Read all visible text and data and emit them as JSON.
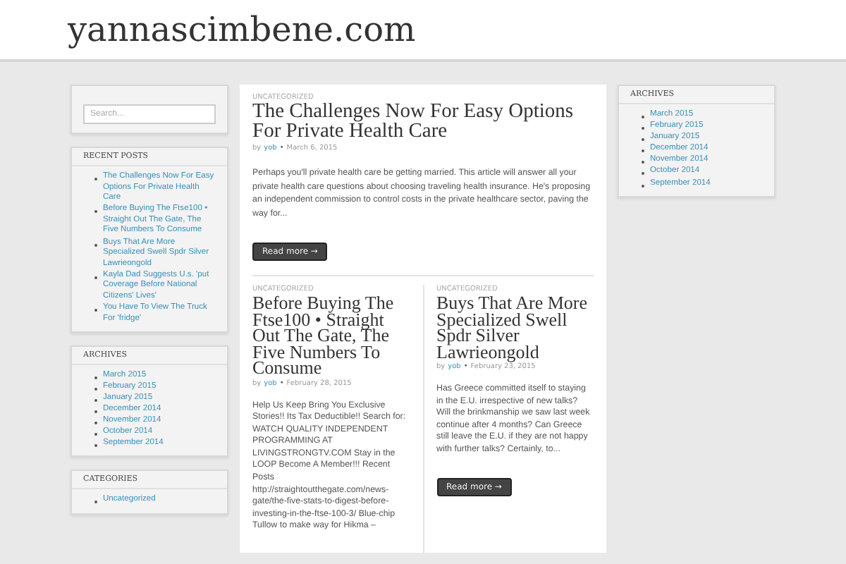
{
  "site_title": "yannascimbene.com",
  "left_sidebar": {
    "search": {
      "placeholder": "Search..."
    },
    "widgets": [
      {
        "title": "RECENT POSTS",
        "items": [
          "The Challenges Now For Easy Options For Private Health Care",
          "Before Buying The Ftse100 • Straight Out The Gate, The Five Numbers To Consume",
          "Buys That Are More Specialized Swell Spdr Silver Lawrieongold",
          "Kayla Dad Suggests U.s. 'put Coverage Before National Citizens' Lives'",
          "You Have To View The Truck For 'fridge'"
        ]
      },
      {
        "title": "ARCHIVES",
        "items": [
          "March 2015",
          "February 2015",
          "January 2015",
          "December 2014",
          "November 2014",
          "October 2014",
          "September 2014"
        ]
      },
      {
        "title": "CATEGORIES",
        "items": [
          "Uncategorized"
        ]
      }
    ]
  },
  "featured_post": {
    "category": "UNCATEGORIZED",
    "title": "The Challenges Now For Easy Options For Private Health Care",
    "by": "by",
    "author": "yob",
    "separator": "•",
    "date": "March 6, 2015",
    "excerpt": "Perhaps you'll private health care be getting married. This article will answer all your private health care questions about choosing traveling health insurance. He's proposing an independent commission to control costs in the private healthcare sector, paving the way for...",
    "button": "Read more →"
  },
  "posts": [
    {
      "category": "UNCATEGORIZED",
      "title": "Before Buying The Ftse100 • Straight Out The Gate, The Five Numbers To Consume",
      "by": "by",
      "author": "yob",
      "separator": "•",
      "date": "February 28, 2015",
      "excerpt": "Help Us Keep Bring You Exclusive Stories!! Its Tax Deductible!! Search for: WATCH QUALITY INDEPENDENT PROGRAMMING AT LIVINGSTRONGTV.COM Stay in the LOOP Become A Member!!! Recent Posts http://straightoutthegate.com/news-gate/the-five-stats-to-digest-before-investing-in-the-ftse-100-3/ Blue-chip Tullow to make way for Hikma –"
    },
    {
      "category": "UNCATEGORIZED",
      "title": "Buys That Are More Specialized Swell Spdr Silver Lawrieongold",
      "by": "by",
      "author": "yob",
      "separator": "•",
      "date": "February 23, 2015",
      "excerpt": "Has Greece committed itself to staying in the E.U. irrespective of new talks? Will the brinkmanship we saw last week continue after 4 months? Can Greece still leave the E.U. if they are not happy with further talks? Certainly, to...",
      "button": "Read more →"
    }
  ],
  "right_sidebar": {
    "widgets": [
      {
        "title": "ARCHIVES",
        "items": [
          "March 2015",
          "February 2015",
          "January 2015",
          "December 2014",
          "November 2014",
          "October 2014",
          "September 2014"
        ]
      }
    ]
  }
}
